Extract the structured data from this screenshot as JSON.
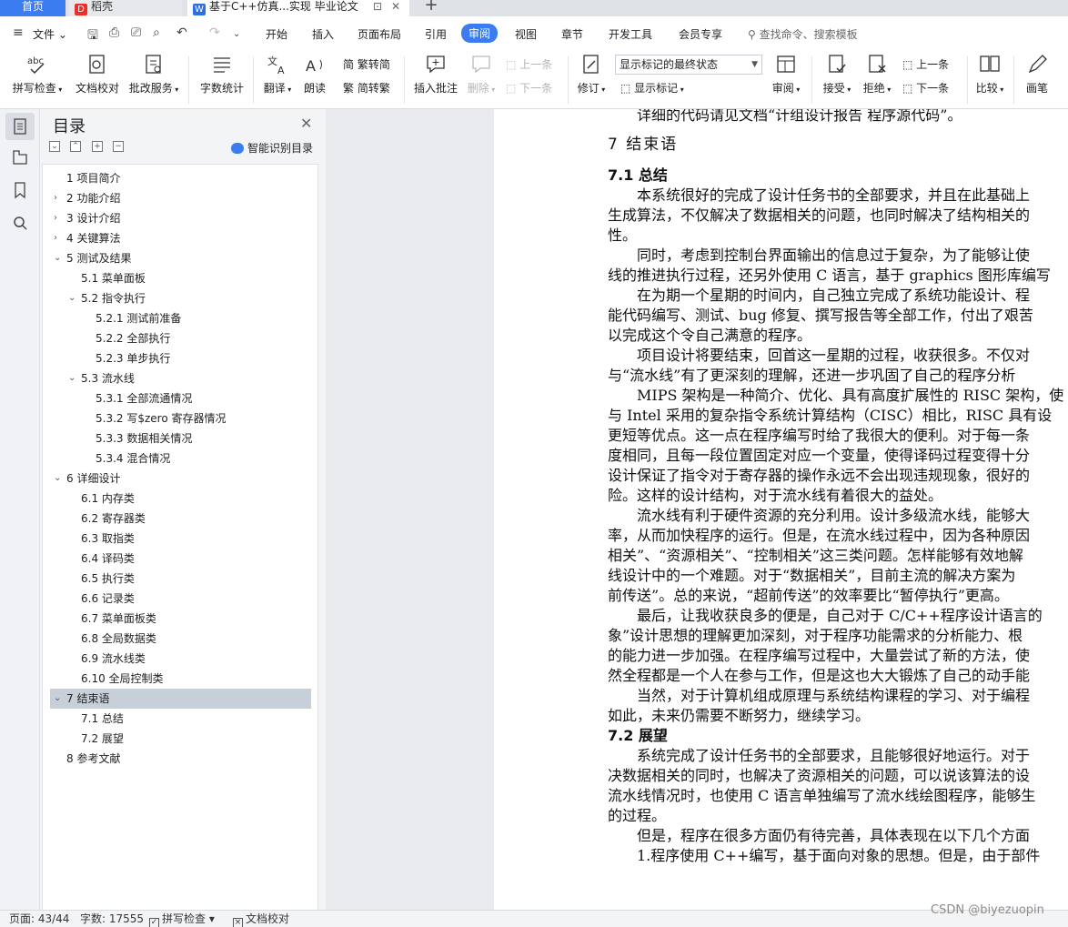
{
  "tabs": {
    "home": "首页",
    "daoke": "稻壳",
    "doc": "基于C++仿真...实现 毕业论文",
    "new": "+"
  },
  "menu": {
    "file": "文件",
    "items": [
      "开始",
      "插入",
      "页面布局",
      "引用",
      "审阅",
      "视图",
      "章节",
      "开发工具",
      "会员专享"
    ],
    "active_index": 4,
    "search_placeholder": "查找命令、搜索模板"
  },
  "ribbon": {
    "spell_check": "拼写检查",
    "doc_proof": "文档校对",
    "batch_service": "批改服务",
    "word_count": "字数统计",
    "translate": "翻译",
    "read_aloud": "朗读",
    "trad_to_simp": "繁转简",
    "simp_to_trad": "简转繁",
    "insert_comment": "插入批注",
    "delete": "删除",
    "prev_comment": "上一条",
    "next_comment": "下一条",
    "revise": "修订",
    "markup_select": "显示标记的最终状态",
    "show_markup": "显示标记",
    "review": "审阅",
    "accept": "接受",
    "reject": "拒绝",
    "prev_change": "上一条",
    "next_change": "下一条",
    "compare": "比较",
    "pen": "画笔"
  },
  "toc": {
    "title": "目录",
    "smart": "智能识别目录",
    "items": [
      {
        "text": "1  项目简介",
        "level": 1,
        "chev": ""
      },
      {
        "text": "2  功能介绍",
        "level": 1,
        "chev": "›"
      },
      {
        "text": "3  设计介绍",
        "level": 1,
        "chev": "›"
      },
      {
        "text": "4  关键算法",
        "level": 1,
        "chev": "›"
      },
      {
        "text": "5  测试及结果",
        "level": 1,
        "chev": "⌄"
      },
      {
        "text": "5.1  菜单面板",
        "level": 2,
        "chev": ""
      },
      {
        "text": "5.2  指令执行",
        "level": 2,
        "chev": "⌄"
      },
      {
        "text": "5.2.1  测试前准备",
        "level": 3,
        "chev": ""
      },
      {
        "text": "5.2.2  全部执行",
        "level": 3,
        "chev": ""
      },
      {
        "text": "5.2.3  单步执行",
        "level": 3,
        "chev": ""
      },
      {
        "text": "5.3  流水线",
        "level": 2,
        "chev": "⌄"
      },
      {
        "text": "5.3.1  全部流通情况",
        "level": 3,
        "chev": ""
      },
      {
        "text": "5.3.2  写$zero 寄存器情况",
        "level": 3,
        "chev": ""
      },
      {
        "text": "5.3.3  数据相关情况",
        "level": 3,
        "chev": ""
      },
      {
        "text": "5.3.4  混合情况",
        "level": 3,
        "chev": ""
      },
      {
        "text": "6  详细设计",
        "level": 1,
        "chev": "⌄"
      },
      {
        "text": "6.1  内存类",
        "level": 2,
        "chev": ""
      },
      {
        "text": "6.2  寄存器类",
        "level": 2,
        "chev": ""
      },
      {
        "text": "6.3  取指类",
        "level": 2,
        "chev": ""
      },
      {
        "text": "6.4  译码类",
        "level": 2,
        "chev": ""
      },
      {
        "text": "6.5  执行类",
        "level": 2,
        "chev": ""
      },
      {
        "text": "6.6  记录类",
        "level": 2,
        "chev": ""
      },
      {
        "text": "6.7  菜单面板类",
        "level": 2,
        "chev": ""
      },
      {
        "text": "6.8  全局数据类",
        "level": 2,
        "chev": ""
      },
      {
        "text": "6.9  流水线类",
        "level": 2,
        "chev": ""
      },
      {
        "text": "6.10  全局控制类",
        "level": 2,
        "chev": ""
      },
      {
        "text": "7  结束语",
        "level": 1,
        "chev": "⌄"
      },
      {
        "text": "7.1  总结",
        "level": 2,
        "chev": ""
      },
      {
        "text": "7.2  展望",
        "level": 2,
        "chev": ""
      },
      {
        "text": "8  参考文献",
        "level": 1,
        "chev": ""
      }
    ],
    "selected_index": 26
  },
  "document": {
    "lines": [
      {
        "t": "详细的代码请见文档“计组设计报告 程序源代码”。",
        "c": "ind"
      },
      {
        "t": "7  结束语",
        "c": "h1"
      },
      {
        "t": "7.1  总结",
        "c": "h2"
      },
      {
        "t": "本系统很好的完成了设计任务书的全部要求，并且在此基础上",
        "c": "ind"
      },
      {
        "t": "生成算法，不仅解决了数据相关的问题，也同时解决了结构相关的",
        "c": ""
      },
      {
        "t": "性。",
        "c": ""
      },
      {
        "t": "同时，考虑到控制台界面输出的信息过于复杂，为了能够让使",
        "c": "ind"
      },
      {
        "t": "线的推进执行过程，还另外使用 C 语言，基于 graphics 图形库编写",
        "c": ""
      },
      {
        "t": "在为期一个星期的时间内，自己独立完成了系统功能设计、程",
        "c": "ind"
      },
      {
        "t": "能代码编写、测试、bug 修复、撰写报告等全部工作，付出了艰苦",
        "c": ""
      },
      {
        "t": "以完成这个令自己满意的程序。",
        "c": ""
      },
      {
        "t": "项目设计将要结束，回首这一星期的过程，收获很多。不仅对",
        "c": "ind"
      },
      {
        "t": "与“流水线”有了更深刻的理解，还进一步巩固了自己的程序分析",
        "c": ""
      },
      {
        "t": "MIPS 架构是一种简介、优化、具有高度扩展性的 RISC 架构，使",
        "c": "ind"
      },
      {
        "t": "与 Intel 采用的复杂指令系统计算结构（CISC）相比，RISC 具有设",
        "c": ""
      },
      {
        "t": "更短等优点。这一点在程序编写时给了我很大的便利。对于每一条",
        "c": ""
      },
      {
        "t": "度相同，且每一段位置固定对应一个变量，使得译码过程变得十分",
        "c": ""
      },
      {
        "t": "设计保证了指令对于寄存器的操作永远不会出现违规现象，很好的",
        "c": ""
      },
      {
        "t": "险。这样的设计结构，对于流水线有着很大的益处。",
        "c": ""
      },
      {
        "t": "流水线有利于硬件资源的充分利用。设计多级流水线，能够大",
        "c": "ind"
      },
      {
        "t": "率，从而加快程序的运行。但是，在流水线过程中，因为各种原因",
        "c": ""
      },
      {
        "t": "相关”、“资源相关”、“控制相关”这三类问题。怎样能够有效地解",
        "c": ""
      },
      {
        "t": "线设计中的一个难题。对于“数据相关”，目前主流的解决方案为",
        "c": ""
      },
      {
        "t": "前传送”。总的来说，“超前传送”的效率要比“暂停执行”更高。",
        "c": ""
      },
      {
        "t": "最后，让我收获良多的便是，自己对于 C/C++程序设计语言的",
        "c": "ind"
      },
      {
        "t": "象”设计思想的理解更加深刻，对于程序功能需求的分析能力、根",
        "c": ""
      },
      {
        "t": "的能力进一步加强。在程序编写过程中，大量尝试了新的方法，使",
        "c": ""
      },
      {
        "t": "然全程都是一个人在参与工作，但是这也大大锻炼了自己的动手能",
        "c": ""
      },
      {
        "t": "当然，对于计算机组成原理与系统结构课程的学习、对于编程",
        "c": "ind"
      },
      {
        "t": "如此，未来仍需要不断努力，继续学习。",
        "c": ""
      },
      {
        "t": "7.2  展望",
        "c": "h2"
      },
      {
        "t": "系统完成了设计任务书的全部要求，且能够很好地运行。对于",
        "c": "ind"
      },
      {
        "t": "决数据相关的同时，也解决了资源相关的问题，可以说该算法的设",
        "c": ""
      },
      {
        "t": "流水线情况时，也使用 C 语言单独编写了流水线绘图程序，能够生",
        "c": ""
      },
      {
        "t": "的过程。",
        "c": ""
      },
      {
        "t": "但是，程序在很多方面仍有待完善，具体表现在以下几个方面",
        "c": "ind"
      },
      {
        "t": "1.程序使用 C++编写，基于面向对象的思想。但是，由于部件",
        "c": "ind"
      }
    ]
  },
  "status": {
    "page": "页面: 43/44",
    "words": "字数: 17555",
    "spell": "拼写检查",
    "proof": "文档校对"
  },
  "watermark": "CSDN @biyezuopin",
  "colors": {
    "accent": "#3b7cf0",
    "selected_toc": "#c7cfd9"
  }
}
